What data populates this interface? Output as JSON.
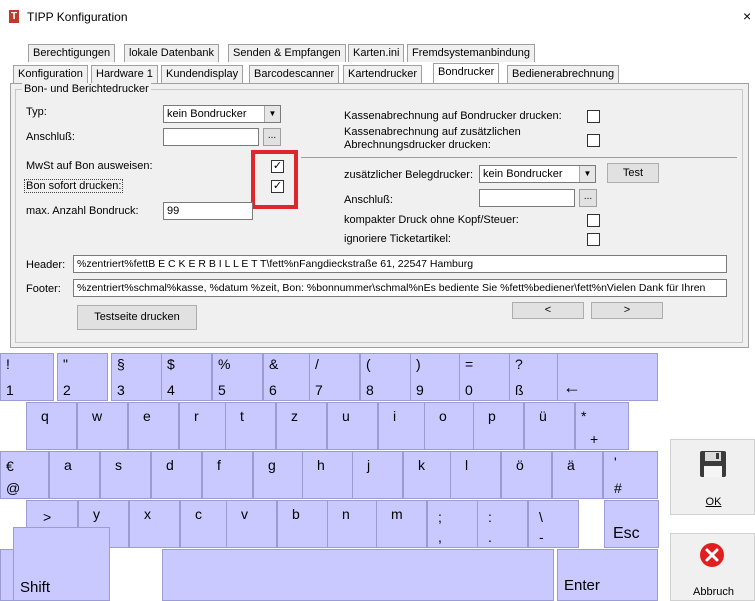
{
  "window": {
    "title": "TIPP Konfiguration",
    "close": "×"
  },
  "tabs_row1": [
    "Berechtigungen",
    "lokale Datenbank",
    "Senden & Empfangen",
    "Karten.ini",
    "Fremdsystemanbindung"
  ],
  "tabs_row2": [
    "Konfiguration",
    "Hardware 1",
    "Kundendisplay",
    "Barcodescanner",
    "Kartendrucker",
    "Bondrucker",
    "Bedienerabrechnung"
  ],
  "active_tab": "Bondrucker",
  "group_title": "Bon- und Berichtedrucker",
  "left": {
    "typ_label": "Typ:",
    "typ_value": "kein Bondrucker",
    "anschluss_label": "Anschluß:",
    "anschluss_value": "",
    "mwst_label": "MwSt auf Bon ausweisen:",
    "mwst_checked": "✓",
    "sofort_label": "Bon sofort drucken:",
    "sofort_checked": "✓",
    "max_label": "max. Anzahl Bondruck:",
    "max_value": "99"
  },
  "right": {
    "kasse_label": "Kassenabrechnung auf Bondrucker drucken:",
    "kasse_zus_label_1": "Kassenabrechnung auf zusätzlichen",
    "kasse_zus_label_2": "Abrechnungsdrucker drucken:",
    "zus_beleg_label": "zusätzlicher Belegdrucker:",
    "zus_beleg_value": "kein Bondrucker",
    "test_label": "Test",
    "anschluss_label": "Anschluß:",
    "kompakt_label": "kompakter Druck ohne Kopf/Steuer:",
    "ignoriere_label": "ignoriere Ticketartikel:"
  },
  "header_label": "Header:",
  "header_value": "%zentriert%fettB E C K E R B I L L E T T\\fett%nFangdieckstraße 61, 22547 Hamburg",
  "footer_label": "Footer:",
  "footer_value": "%zentriert%schmal%kasse, %datum %zeit, Bon: %bonnummer\\schmal%nEs bediente Sie %fett%bediener\\fett%nVielen Dank für Ihren",
  "testseite_label": "Testseite drucken",
  "nav_prev": "<",
  "nav_next": ">",
  "ellipsis": "...",
  "dropdown_arrow": "▼",
  "keyboard": {
    "row1": [
      {
        "top": "!",
        "bot": "1"
      },
      {
        "top": "\"",
        "bot": "2"
      },
      {
        "top": "§",
        "bot": "3"
      },
      {
        "top": "$",
        "bot": "4"
      },
      {
        "top": "%",
        "bot": "5"
      },
      {
        "top": "&",
        "bot": "6"
      },
      {
        "top": "/",
        "bot": "7"
      },
      {
        "top": "(",
        "bot": "8"
      },
      {
        "top": ")",
        "bot": "9"
      },
      {
        "top": "=",
        "bot": "0"
      },
      {
        "top": "?",
        "bot": "ß"
      }
    ],
    "backspace": "←",
    "row2": [
      "q",
      "w",
      "e",
      "r",
      "t",
      "z",
      "u",
      "i",
      "o",
      "p",
      "ü"
    ],
    "row2_plus": {
      "top": "*",
      "bot": "+"
    },
    "row3_euro": {
      "top": "€",
      "bot": "@"
    },
    "row3": [
      "a",
      "s",
      "d",
      "f",
      "g",
      "h",
      "j",
      "k",
      "l",
      "ö",
      "ä"
    ],
    "row3_hash": {
      "top": "'",
      "bot": "#"
    },
    "row4_angle": {
      "top": ">",
      "bot": "<"
    },
    "row4": [
      "y",
      "x",
      "c",
      "v",
      "b",
      "n",
      "m"
    ],
    "row4_punct": [
      {
        "top": ";",
        "bot": ","
      },
      {
        "top": ":",
        "bot": "."
      },
      {
        "top": "\\",
        "bot": "-"
      }
    ],
    "esc": "Esc",
    "shift": "Shift",
    "enter": "Enter"
  },
  "side": {
    "ok_label": "OK",
    "cancel_label": "Abbruch"
  },
  "colors": {
    "key_bg": "#c9c9ff",
    "highlight": "#e0262d"
  }
}
